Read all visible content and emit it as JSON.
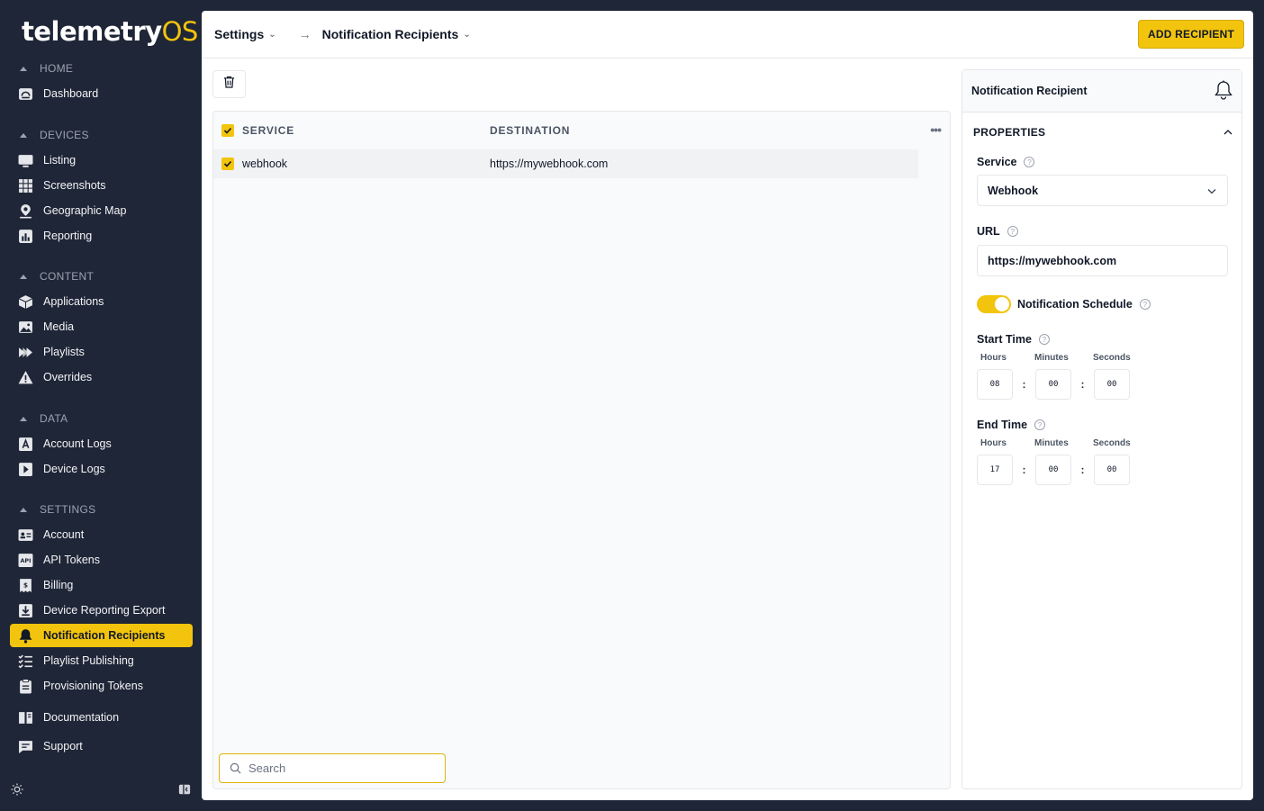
{
  "brand": {
    "name_main": "telemetry",
    "name_accent": "OS",
    "accent_color": "#f2c40d"
  },
  "sidebar": {
    "sections": [
      {
        "title": "HOME",
        "items": [
          {
            "label": "Dashboard",
            "icon": "dashboard-icon"
          }
        ]
      },
      {
        "title": "DEVICES",
        "items": [
          {
            "label": "Listing",
            "icon": "monitor-icon"
          },
          {
            "label": "Screenshots",
            "icon": "grid-icon"
          },
          {
            "label": "Geographic Map",
            "icon": "map-pin-icon"
          },
          {
            "label": "Reporting",
            "icon": "chart-icon"
          }
        ]
      },
      {
        "title": "CONTENT",
        "items": [
          {
            "label": "Applications",
            "icon": "cube-icon"
          },
          {
            "label": "Media",
            "icon": "image-icon"
          },
          {
            "label": "Playlists",
            "icon": "playlist-icon"
          },
          {
            "label": "Overrides",
            "icon": "warning-icon"
          }
        ]
      },
      {
        "title": "DATA",
        "items": [
          {
            "label": "Account Logs",
            "icon": "account-log-icon"
          },
          {
            "label": "Device Logs",
            "icon": "device-log-icon"
          }
        ]
      },
      {
        "title": "SETTINGS",
        "items": [
          {
            "label": "Account",
            "icon": "id-card-icon"
          },
          {
            "label": "API Tokens",
            "icon": "api-icon"
          },
          {
            "label": "Billing",
            "icon": "billing-icon"
          },
          {
            "label": "Device Reporting Export",
            "icon": "download-icon"
          },
          {
            "label": "Notification Recipients",
            "icon": "bell-icon",
            "active": true
          },
          {
            "label": "Playlist Publishing",
            "icon": "checklist-icon"
          },
          {
            "label": "Provisioning Tokens",
            "icon": "clipboard-icon"
          }
        ]
      }
    ],
    "extra": [
      {
        "label": "Documentation",
        "icon": "book-icon"
      },
      {
        "label": "Support",
        "icon": "chat-icon"
      }
    ]
  },
  "header": {
    "crumb1": "Settings",
    "crumb2": "Notification Recipients",
    "add_button": "ADD RECIPIENT"
  },
  "table": {
    "columns": {
      "service": "SERVICE",
      "destination": "DESTINATION"
    },
    "rows": [
      {
        "service": "webhook",
        "destination": "https://mywebhook.com",
        "checked": true
      }
    ],
    "search_placeholder": "Search"
  },
  "props": {
    "title": "Notification Recipient",
    "section": "PROPERTIES",
    "service_label": "Service",
    "service_value": "Webhook",
    "url_label": "URL",
    "url_value": "https://mywebhook.com",
    "schedule_label": "Notification Schedule",
    "schedule_on": true,
    "start_label": "Start Time",
    "end_label": "End Time",
    "hours": "Hours",
    "minutes": "Minutes",
    "seconds": "Seconds",
    "start": {
      "h": "08",
      "m": "00",
      "s": "00"
    },
    "end": {
      "h": "17",
      "m": "00",
      "s": "00"
    },
    "colon": ":"
  }
}
